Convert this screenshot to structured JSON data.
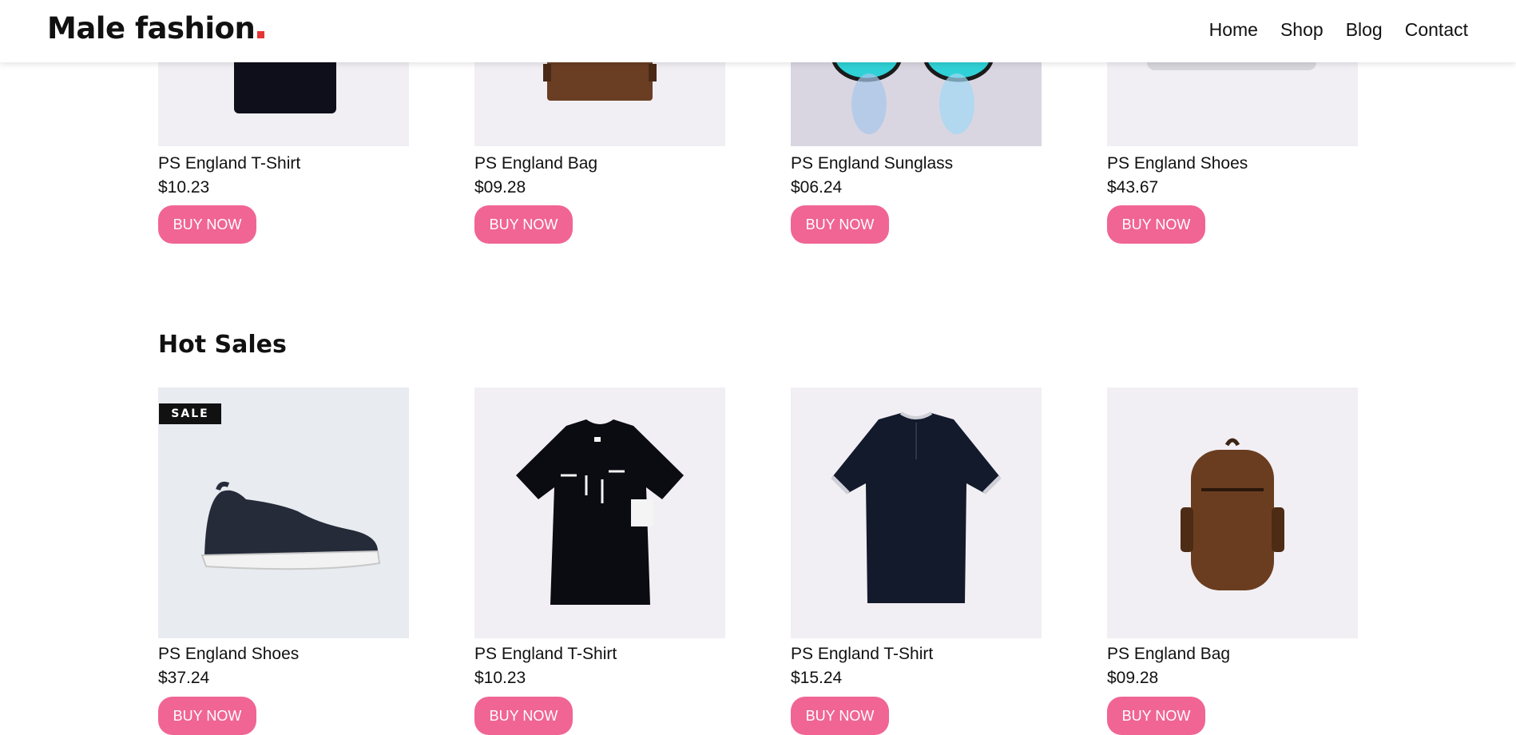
{
  "brand": {
    "name": "Male fashion",
    "dot_color": "#e53637"
  },
  "nav": {
    "items": [
      "Home",
      "Shop",
      "Blog",
      "Contact"
    ]
  },
  "accent_color": "#f06594",
  "top_row": [
    {
      "name": "PS England T-Shirt",
      "price": "$10.23",
      "button": "BUY NOW",
      "image": "tshirt-icon"
    },
    {
      "name": "PS England Bag",
      "price": "$09.28",
      "button": "BUY NOW",
      "image": "bag-icon"
    },
    {
      "name": "PS England Sunglass",
      "price": "$06.24",
      "button": "BUY NOW",
      "image": "sunglasses-icon"
    },
    {
      "name": "PS England Shoes",
      "price": "$43.67",
      "button": "BUY NOW",
      "image": "shoes-icon"
    }
  ],
  "hot_sales": {
    "title": "Hot Sales",
    "items": [
      {
        "name": "PS England Shoes",
        "price": "$37.24",
        "button": "BUY NOW",
        "badge": "SALE",
        "image": "sneaker-icon"
      },
      {
        "name": "PS England T-Shirt",
        "price": "$10.23",
        "button": "BUY NOW",
        "image": "tshirt-icon"
      },
      {
        "name": "PS England T-Shirt",
        "price": "$15.24",
        "button": "BUY NOW",
        "image": "polo-shirt-icon"
      },
      {
        "name": "PS England Bag",
        "price": "$09.28",
        "button": "BUY NOW",
        "image": "backpack-icon"
      }
    ]
  }
}
